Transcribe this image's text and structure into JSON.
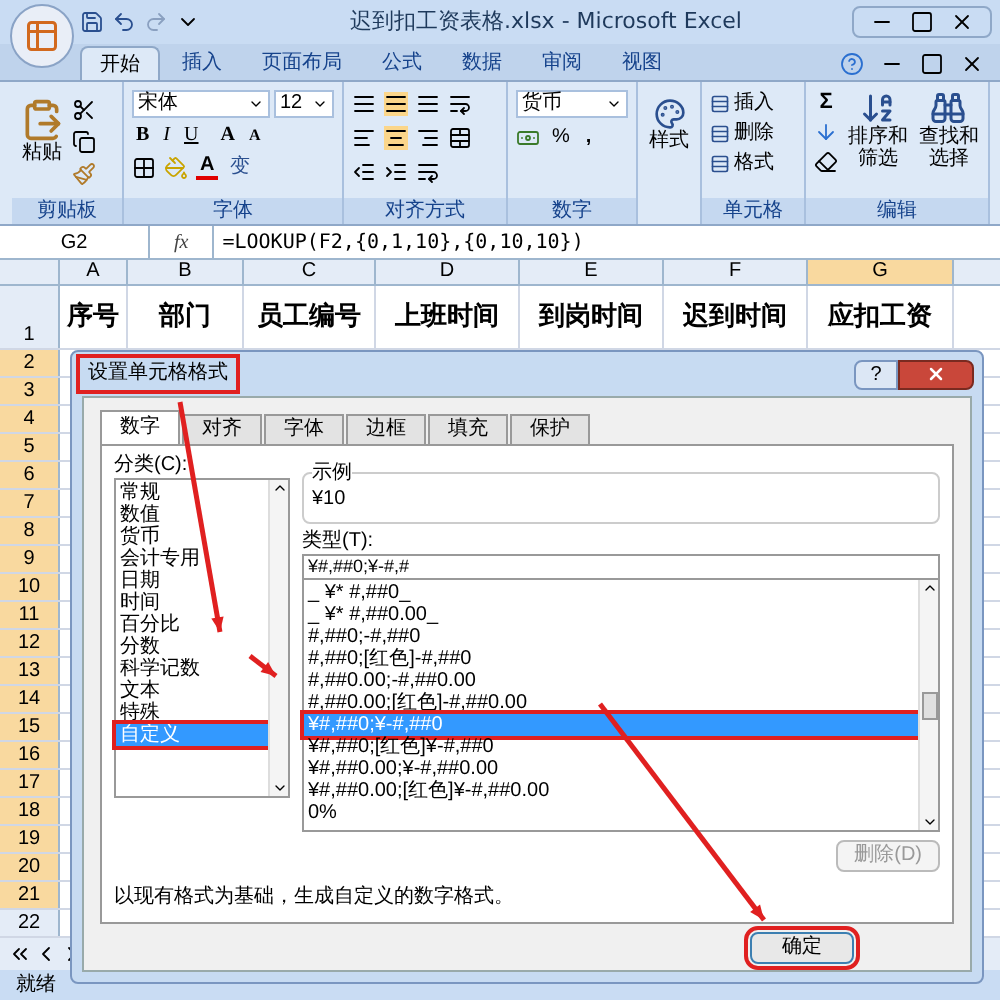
{
  "window": {
    "title": "迟到扣工资表格.xlsx - Microsoft Excel"
  },
  "ribbon_tabs": [
    {
      "label": "开始",
      "selected": true
    },
    {
      "label": "插入",
      "selected": false
    },
    {
      "label": "页面布局",
      "selected": false
    },
    {
      "label": "公式",
      "selected": false
    },
    {
      "label": "数据",
      "selected": false
    },
    {
      "label": "审阅",
      "selected": false
    },
    {
      "label": "视图",
      "selected": false
    }
  ],
  "ribbon": {
    "clipboard": {
      "label": "剪贴板",
      "paste": "粘贴"
    },
    "font": {
      "label": "字体",
      "name": "宋体",
      "size": "12",
      "bold": "B",
      "italic": "I",
      "underline": "U",
      "grow": "A",
      "shrink": "A",
      "color_label": "A",
      "phonetic": "变"
    },
    "alignment": {
      "label": "对齐方式"
    },
    "number": {
      "label": "数字",
      "format": "货币",
      "percent": "%",
      "comma": ","
    },
    "styles": {
      "button": "样式"
    },
    "cells": {
      "label": "单元格",
      "items": [
        "插入",
        "删除",
        "格式"
      ]
    },
    "editing": {
      "label": "编辑",
      "sum": "Σ",
      "sort": "排序和筛选",
      "find": "查找和选择"
    }
  },
  "formula_bar": {
    "name_box": "G2",
    "function_label": "fx",
    "formula": "=LOOKUP(F2,{0,1,10},{0,10,10})"
  },
  "sheet": {
    "columns": [
      {
        "label": "A",
        "selected": false
      },
      {
        "label": "B",
        "selected": false
      },
      {
        "label": "C",
        "selected": false
      },
      {
        "label": "D",
        "selected": false
      },
      {
        "label": "E",
        "selected": false
      },
      {
        "label": "F",
        "selected": false
      },
      {
        "label": "G",
        "selected": true
      }
    ],
    "header_row": [
      "序号",
      "部门",
      "员工编号",
      "上班时间",
      "到岗时间",
      "迟到时间",
      "应扣工资"
    ],
    "rows": [
      {
        "label": "1",
        "selected": false
      },
      {
        "label": "2",
        "selected": true
      },
      {
        "label": "3",
        "selected": true
      },
      {
        "label": "4",
        "selected": true
      },
      {
        "label": "5",
        "selected": true
      },
      {
        "label": "6",
        "selected": true
      },
      {
        "label": "7",
        "selected": true
      },
      {
        "label": "8",
        "selected": true
      },
      {
        "label": "9",
        "selected": true
      },
      {
        "label": "10",
        "selected": true
      },
      {
        "label": "11",
        "selected": true
      },
      {
        "label": "12",
        "selected": true
      },
      {
        "label": "13",
        "selected": true
      },
      {
        "label": "14",
        "selected": true
      },
      {
        "label": "15",
        "selected": true
      },
      {
        "label": "16",
        "selected": true
      },
      {
        "label": "17",
        "selected": true
      },
      {
        "label": "18",
        "selected": true
      },
      {
        "label": "19",
        "selected": true
      },
      {
        "label": "20",
        "selected": true
      },
      {
        "label": "21",
        "selected": true
      },
      {
        "label": "22",
        "selected": false
      }
    ]
  },
  "status_bar": {
    "text": "就绪"
  },
  "dialog": {
    "title": "设置单元格格式",
    "title_highlighted": true,
    "tabs": [
      {
        "label": "数字",
        "selected": true
      },
      {
        "label": "对齐",
        "selected": false
      },
      {
        "label": "字体",
        "selected": false
      },
      {
        "label": "边框",
        "selected": false
      },
      {
        "label": "填充",
        "selected": false
      },
      {
        "label": "保护",
        "selected": false
      }
    ],
    "category_label": "分类(C):",
    "categories": [
      {
        "label": "常规",
        "selected": false,
        "highlighted": false
      },
      {
        "label": "数值",
        "selected": false,
        "highlighted": false
      },
      {
        "label": "货币",
        "selected": false,
        "highlighted": false
      },
      {
        "label": "会计专用",
        "selected": false,
        "highlighted": false
      },
      {
        "label": "日期",
        "selected": false,
        "highlighted": false
      },
      {
        "label": "时间",
        "selected": false,
        "highlighted": false
      },
      {
        "label": "百分比",
        "selected": false,
        "highlighted": false
      },
      {
        "label": "分数",
        "selected": false,
        "highlighted": false
      },
      {
        "label": "科学记数",
        "selected": false,
        "highlighted": false
      },
      {
        "label": "文本",
        "selected": false,
        "highlighted": false
      },
      {
        "label": "特殊",
        "selected": false,
        "highlighted": false
      },
      {
        "label": "自定义",
        "selected": true,
        "highlighted": true
      }
    ],
    "sample_label": "示例",
    "sample_value": "¥10",
    "type_label": "类型(T):",
    "type_value": "¥#,##0;¥-#,#",
    "types": [
      {
        "label": "_ ¥* #,##0_",
        "selected": false,
        "highlighted": false
      },
      {
        "label": "_ ¥* #,##0.00_",
        "selected": false,
        "highlighted": false
      },
      {
        "label": "#,##0;-#,##0",
        "selected": false,
        "highlighted": false
      },
      {
        "label": "#,##0;[红色]-#,##0",
        "selected": false,
        "highlighted": false
      },
      {
        "label": "#,##0.00;-#,##0.00",
        "selected": false,
        "highlighted": false
      },
      {
        "label": "#,##0.00;[红色]-#,##0.00",
        "selected": false,
        "highlighted": false
      },
      {
        "label": "¥#,##0;¥-#,##0",
        "selected": true,
        "highlighted": true
      },
      {
        "label": "¥#,##0;[红色]¥-#,##0",
        "selected": false,
        "highlighted": false
      },
      {
        "label": "¥#,##0.00;¥-#,##0.00",
        "selected": false,
        "highlighted": false
      },
      {
        "label": "¥#,##0.00;[红色]¥-#,##0.00",
        "selected": false,
        "highlighted": false
      },
      {
        "label": "0%",
        "selected": false,
        "highlighted": false
      }
    ],
    "delete_button": {
      "label": "删除(D)",
      "disabled": true
    },
    "help_button": "?",
    "description": "以现有格式为基础，生成自定义的数字格式。",
    "ok_button": {
      "label": "确定",
      "highlighted": true
    }
  }
}
